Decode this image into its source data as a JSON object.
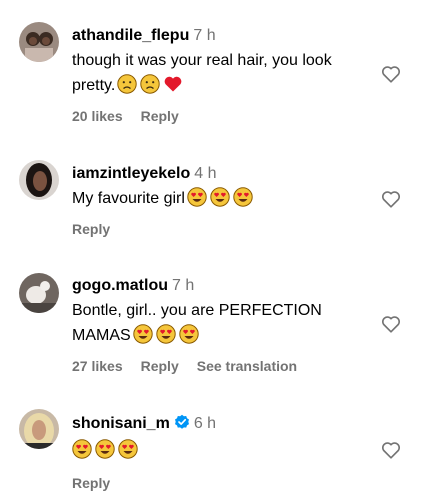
{
  "comments": [
    {
      "username": "athandile_flepu",
      "time": "7 h",
      "text": "though it was your real hair, you look pretty.",
      "emojis": [
        "sad-face-emoji",
        "sad-face-emoji",
        "red-heart-emoji"
      ],
      "likes": "20 likes",
      "reply": "Reply"
    },
    {
      "username": "iamzintleyekelo",
      "time": "4 h",
      "text": "My favourite girl",
      "emojis": [
        "heart-eyes-emoji",
        "heart-eyes-emoji",
        "heart-eyes-emoji"
      ],
      "reply": "Reply"
    },
    {
      "username": "gogo.matlou",
      "time": "7 h",
      "text": "Bontle, girl.. you are PERFECTION MAMAS",
      "emojis": [
        "heart-eyes-emoji",
        "heart-eyes-emoji",
        "heart-eyes-emoji"
      ],
      "likes": "27 likes",
      "reply": "Reply",
      "translate": "See translation"
    },
    {
      "username": "shonisani_m",
      "verified": true,
      "time": "6 h",
      "text": "",
      "emojis": [
        "heart-eyes-emoji",
        "heart-eyes-emoji",
        "heart-eyes-emoji"
      ],
      "reply": "Reply"
    }
  ],
  "colors": {
    "secondary_text": "#737373",
    "verified_blue": "#0095f6",
    "heart_red": "#ff3040"
  },
  "icons": {
    "like": "heart-outline-icon",
    "verified": "verified-badge-icon"
  }
}
